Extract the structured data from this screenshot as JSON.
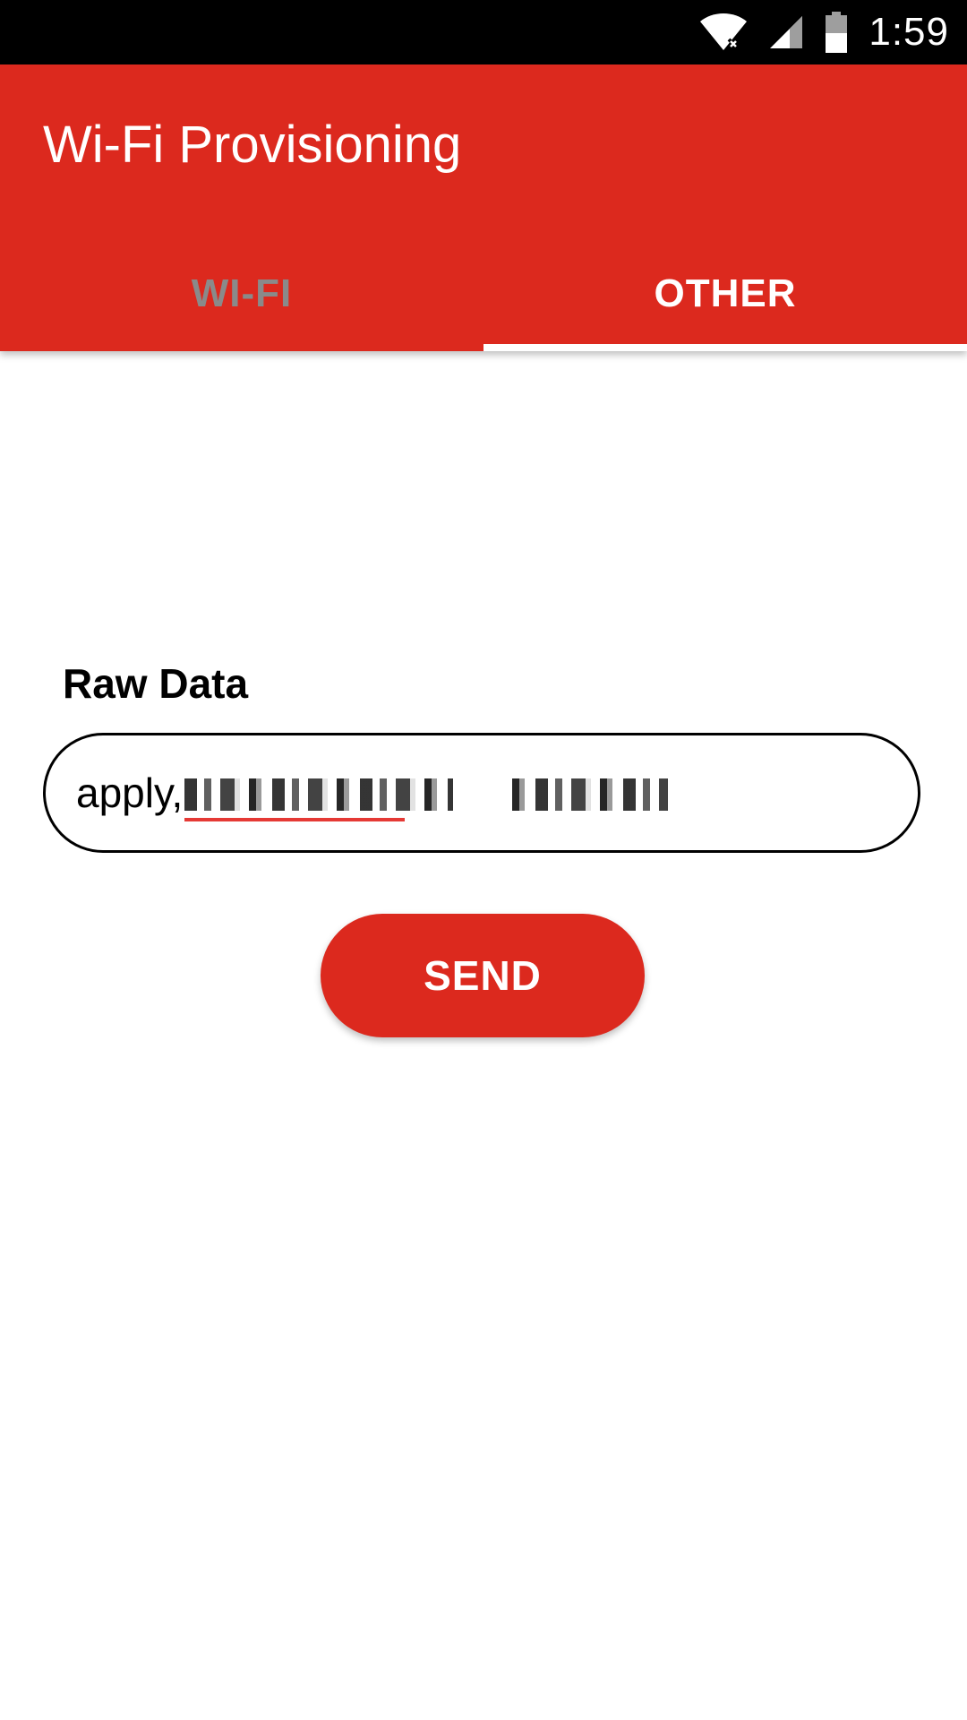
{
  "status_bar": {
    "time": "1:59",
    "icons": [
      "wifi-no-internet-icon",
      "cell-signal-icon",
      "battery-icon"
    ]
  },
  "app_bar": {
    "title": "Wi-Fi Provisioning",
    "background_color": "#dc291e"
  },
  "tabs": [
    {
      "label": "WI-FI",
      "selected": false
    },
    {
      "label": "OTHER",
      "selected": true
    }
  ],
  "form": {
    "raw_data_label": "Raw Data",
    "raw_data_value_visible": "apply,",
    "raw_data_value_redacted": true,
    "send_label": "SEND"
  }
}
